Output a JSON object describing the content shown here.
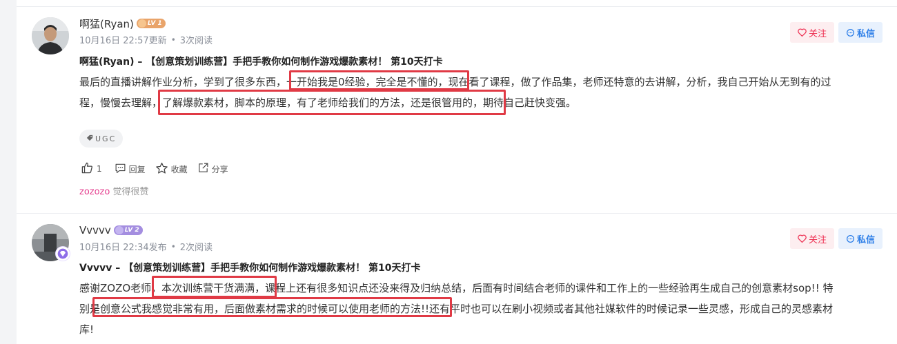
{
  "posts": [
    {
      "name": "啊猛(Ryan)",
      "level": "LV 1",
      "date": "10月16日 22:57更新",
      "reads": "3次阅读",
      "follow_label": "关注",
      "message_label": "私信",
      "title": "啊猛(Ryan) – 【创意策划训练营】手把手教你如何制作游戏爆款素材！ 第10天打卡",
      "content_line1": "最后的直播讲解作业分析，学到了很多东西，一开始我是0经验，完全是不懂的，现在看了课程，做了作品集，老师还特意的去讲解，分析，我自己开始从无到有的过",
      "content_line2": "程，慢慢去理解，了解爆款素材，脚本的原理，有了老师给我们的方法，还是很管用的，期待自己赶快变强。",
      "tag": "UGC",
      "like_count": "1",
      "reply_label": "回复",
      "collect_label": "收藏",
      "share_label": "分享",
      "liked_user": "zozozo",
      "liked_text": " 觉得很赞"
    },
    {
      "name": "Vvvvv",
      "level": "LV 2",
      "date": "10月16日 22:34发布",
      "reads": "2次阅读",
      "follow_label": "关注",
      "message_label": "私信",
      "title": "Vvvvv – 【创意策划训练营】手把手教你如何制作游戏爆款素材！ 第10天打卡",
      "content_line1": "感谢ZOZO老师，本次训练营干货满满，课程上还有很多知识点还没来得及归纳总结，后面有时间结合老师的课件和工作上的一些经验再生成自己的创意素材sop!! 特",
      "content_line2": "别是创意公式我感觉非常有用，后面做素材需求的时候可以使用老师的方法!!还有平时也可以在刷小视频或者其他社媒软件的时候记录一些灵感，形成自己的灵感素材",
      "content_line3": "库!"
    }
  ],
  "colors": {
    "highlight": "#e03a45",
    "follow": "#ee3355",
    "message": "#2e7fe8",
    "liked_user": "#e43f8f"
  }
}
